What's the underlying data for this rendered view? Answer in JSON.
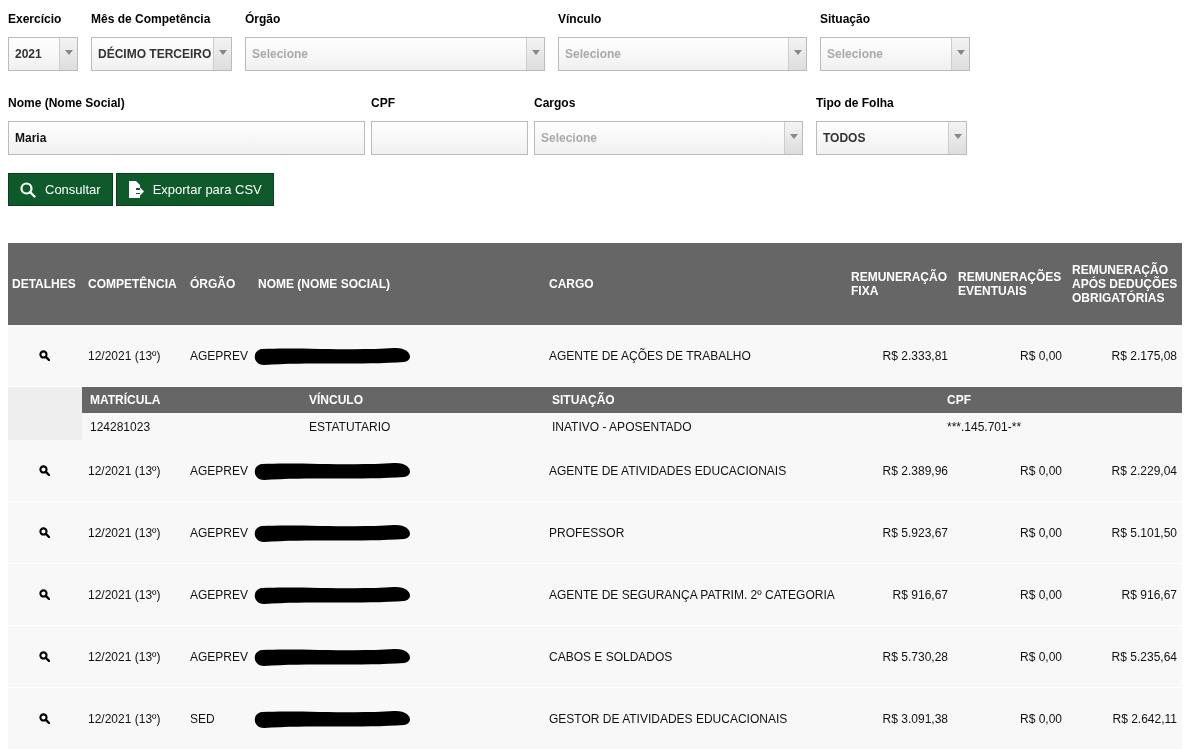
{
  "filters_row_1": [
    {
      "label": "Exercício",
      "kind": "select",
      "value": "2021"
    },
    {
      "label": "Mês de Competência",
      "kind": "select",
      "value": "DÉCIMO TERCEIRO"
    },
    {
      "label": "Órgão",
      "kind": "select",
      "placeholder": "Selecione"
    },
    {
      "label": "Vínculo",
      "kind": "select",
      "placeholder": "Selecione"
    },
    {
      "label": "Situação",
      "kind": "select",
      "placeholder": "Selecione"
    }
  ],
  "filters_row_2": [
    {
      "label": "Nome (Nome Social)",
      "kind": "input",
      "value": "Maria"
    },
    {
      "label": "CPF",
      "kind": "input"
    },
    {
      "label": "Cargos",
      "kind": "select",
      "placeholder": "Selecione"
    },
    {
      "label": "Tipo de Folha",
      "kind": "select",
      "value": "TODOS"
    }
  ],
  "buttons": [
    {
      "label": "Consultar",
      "kind": "search"
    },
    {
      "label": "Exportar para CSV",
      "kind": "export"
    }
  ],
  "table": {
    "columns": [
      "DETALHES",
      "COMPETÊNCIA",
      "ÓRGÃO",
      "NOME (NOME SOCIAL)",
      "CARGO",
      "REMUNERAÇÃO FIXA",
      "REMUNERAÇÕES EVENTUAIS",
      "REMUNERAÇÃO APÓS DEDUÇÕES OBRIGATÓRIAS"
    ],
    "detail_columns": [
      "MATRÍCULA",
      "VÍNCULO",
      "SITUAÇÃO",
      "CPF"
    ],
    "rows": [
      {
        "competencia": "12/2021 (13º)",
        "orgao": "AGEPREV",
        "cargo": "AGENTE DE AÇÕES DE TRABALHO",
        "fixa": "R$ 2.333,81",
        "eventuais": "R$ 0,00",
        "apos": "R$ 2.175,08",
        "expanded": true,
        "detail": [
          "124281023",
          "ESTATUTARIO",
          "INATIVO - APOSENTADO",
          "***.145.701-**"
        ]
      },
      {
        "competencia": "12/2021 (13º)",
        "orgao": "AGEPREV",
        "cargo": "AGENTE DE ATIVIDADES EDUCACIONAIS",
        "fixa": "R$ 2.389,96",
        "eventuais": "R$ 0,00",
        "apos": "R$ 2.229,04",
        "expanded": false
      },
      {
        "competencia": "12/2021 (13º)",
        "orgao": "AGEPREV",
        "cargo": "PROFESSOR",
        "fixa": "R$ 5.923,67",
        "eventuais": "R$ 0,00",
        "apos": "R$ 5.101,50",
        "expanded": false
      },
      {
        "competencia": "12/2021 (13º)",
        "orgao": "AGEPREV",
        "cargo": "AGENTE DE SEGURANÇA PATRIM. 2º CATEGORIA",
        "fixa": "R$ 916,67",
        "eventuais": "R$ 0,00",
        "apos": "R$ 916,67",
        "expanded": false
      },
      {
        "competencia": "12/2021 (13º)",
        "orgao": "AGEPREV",
        "cargo": "CABOS E SOLDADOS",
        "fixa": "R$ 5.730,28",
        "eventuais": "R$ 0,00",
        "apos": "R$ 5.235,64",
        "expanded": false
      },
      {
        "competencia": "12/2021 (13º)",
        "orgao": "SED",
        "cargo": "GESTOR DE ATIVIDADES EDUCACIONAIS",
        "fixa": "R$ 3.091,38",
        "eventuais": "R$ 0,00",
        "apos": "R$ 2.642,11",
        "expanded": false
      }
    ]
  }
}
